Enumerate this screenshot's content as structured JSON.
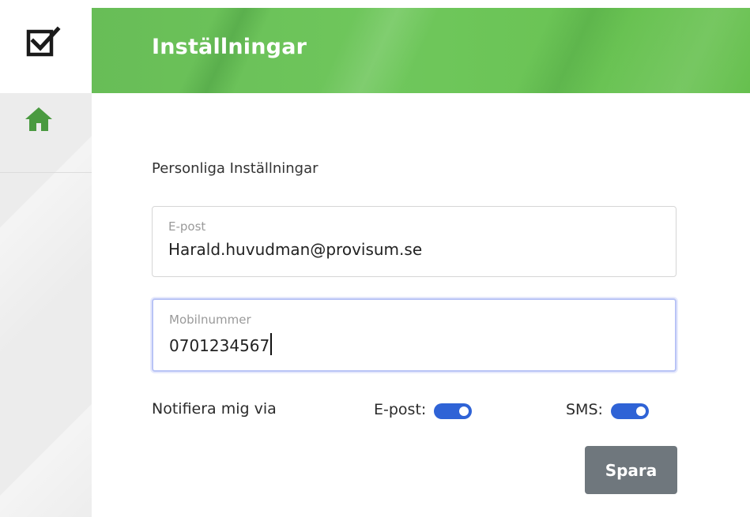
{
  "header": {
    "title": "Inställningar",
    "accent_color": "#6fc75c"
  },
  "sidebar": {
    "logo_icon": "checkbox-check-icon",
    "items": [
      {
        "icon": "home-icon",
        "color": "#4a9a40"
      }
    ]
  },
  "main": {
    "section_title": "Personliga Inställningar",
    "email_field": {
      "label": "E-post",
      "value": "Harald.huvudman@provisum.se"
    },
    "mobile_field": {
      "label": "Mobilnummer",
      "value": "0701234567",
      "focused": true
    },
    "notifications": {
      "label": "Notifiera mig via",
      "email_toggle": {
        "label": "E-post:",
        "enabled": true
      },
      "sms_toggle": {
        "label": "SMS:",
        "enabled": true
      },
      "toggle_color": "#2f63d6"
    },
    "save_label": "Spara",
    "save_button_color": "#6f777d"
  }
}
